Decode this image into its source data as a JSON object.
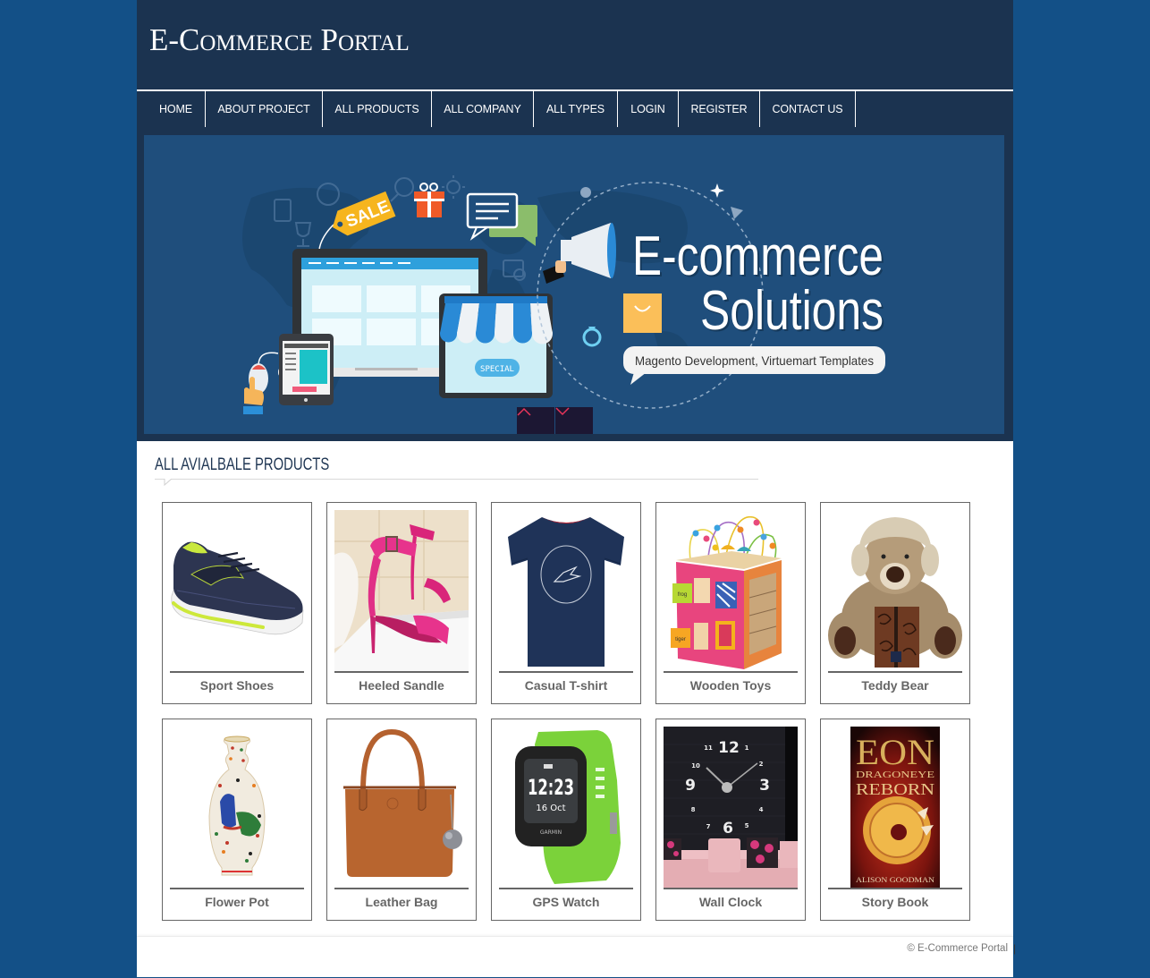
{
  "header": {
    "site_title": "E-Commerce Portal"
  },
  "nav": {
    "items": [
      {
        "label": "HOME"
      },
      {
        "label": "ABOUT PROJECT"
      },
      {
        "label": "ALL PRODUCTS"
      },
      {
        "label": "ALL COMPANY"
      },
      {
        "label": "ALL TYPES"
      },
      {
        "label": "LOGIN"
      },
      {
        "label": "REGISTER"
      },
      {
        "label": "CONTACT US"
      }
    ]
  },
  "banner": {
    "headline_line1": "E-commerce",
    "headline_line2": "Solutions",
    "tagline": "Magento Development, Virtuemart Templates",
    "sale_tag_text": "SALE",
    "store_badge_text": "SPECIAL",
    "controls": {
      "prev_icon": "chevron-up-icon",
      "next_icon": "chevron-down-icon"
    }
  },
  "products_section": {
    "heading": "ALL AVIALBALE PRODUCTS"
  },
  "products": [
    {
      "name": "Sport Shoes",
      "image": "sport-shoes"
    },
    {
      "name": "Heeled Sandle",
      "image": "heeled-sandle"
    },
    {
      "name": "Casual T-shirt",
      "image": "casual-tshirt"
    },
    {
      "name": "Wooden Toys",
      "image": "wooden-toys",
      "image_text": {
        "labels": [
          "frog",
          "tiger"
        ]
      }
    },
    {
      "name": "Teddy Bear",
      "image": "teddy-bear"
    },
    {
      "name": "Flower Pot",
      "image": "flower-pot"
    },
    {
      "name": "Leather Bag",
      "image": "leather-bag"
    },
    {
      "name": "GPS Watch",
      "image": "gps-watch",
      "image_text": {
        "time": "12:23",
        "date": "16 Oct",
        "brand": "GARMIN"
      }
    },
    {
      "name": "Wall Clock",
      "image": "wall-clock",
      "image_text": {
        "numerals": [
          "12",
          "1",
          "2",
          "3",
          "4",
          "5",
          "6",
          "7",
          "8",
          "9",
          "10",
          "11"
        ]
      }
    },
    {
      "name": "Story Book",
      "image": "story-book",
      "image_text": {
        "title": "EON",
        "subtitle_line1": "DRAGONEYE",
        "subtitle_line2": "REBORN",
        "author": "ALISON GOODMAN"
      }
    }
  ],
  "footer": {
    "copyright": "© E-Commerce Portal",
    "separator": "|"
  },
  "colors": {
    "page_bg": "#135087",
    "header_bg": "#1b3350",
    "banner_bg": "#1f4e7c",
    "slider_button_bg": "#1c1733",
    "slider_arrow": "#e8345a",
    "card_border": "#666666",
    "product_name": "#666666"
  }
}
